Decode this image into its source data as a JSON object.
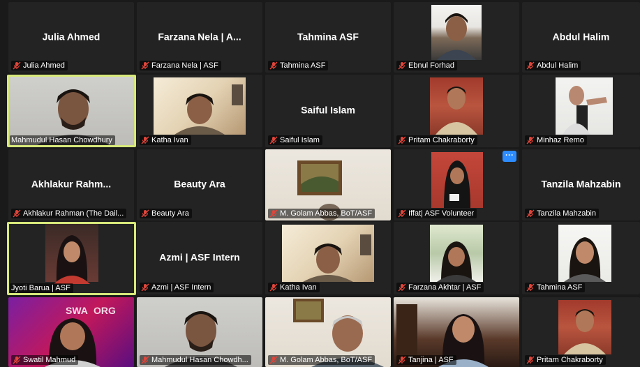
{
  "tiles": [
    {
      "display": "Julia Ahmed",
      "label": "Julia Ahmed"
    },
    {
      "display": "Farzana Nela | A...",
      "label": "Farzana Nela | ASF"
    },
    {
      "display": "Tahmina ASF",
      "label": "Tahmina ASF"
    },
    {
      "display": "",
      "label": "Ebnul Forhad"
    },
    {
      "display": "Abdul Halim",
      "label": "Abdul Halim"
    },
    {
      "display": "",
      "label": "Mahmudul Hasan Chowdhury"
    },
    {
      "display": "",
      "label": "Katha Ivan"
    },
    {
      "display": "Saiful Islam",
      "label": "Saiful Islam"
    },
    {
      "display": "",
      "label": "Pritam Chakraborty"
    },
    {
      "display": "",
      "label": "Minhaz Remo"
    },
    {
      "display": "Akhlakur  Rahm...",
      "label": "Akhlakur Rahman (The Dail..."
    },
    {
      "display": "Beauty Ara",
      "label": "Beauty Ara"
    },
    {
      "display": "",
      "label": "M. Golam Abbas, BoT/ASF"
    },
    {
      "display": "",
      "label": "Iffat| ASF Volunteer"
    },
    {
      "display": "Tanzila Mahzabin",
      "label": "Tanzila Mahzabin"
    },
    {
      "display": "",
      "label": "Jyoti Barua | ASF"
    },
    {
      "display": "Azmi | ASF Intern",
      "label": "Azmi | ASF Intern"
    },
    {
      "display": "",
      "label": "Katha Ivan"
    },
    {
      "display": "",
      "label": "Farzana Akhtar | ASF"
    },
    {
      "display": "",
      "label": "Tahmina ASF"
    },
    {
      "display": "",
      "label": "Swatil Mahmud"
    },
    {
      "display": "",
      "label": "Mahmudul Hasan Chowdh..."
    },
    {
      "display": "",
      "label": "M. Golam Abbas, BoT/ASF"
    },
    {
      "display": "",
      "label": "Tanjina | ASF"
    },
    {
      "display": "",
      "label": "Pritam Chakraborty"
    }
  ],
  "more_button": "···",
  "colors": {
    "active_border": "#d7e87a",
    "tile_bg": "#232323",
    "accent": "#2d8cff",
    "muted_mic": "#e0453a"
  }
}
